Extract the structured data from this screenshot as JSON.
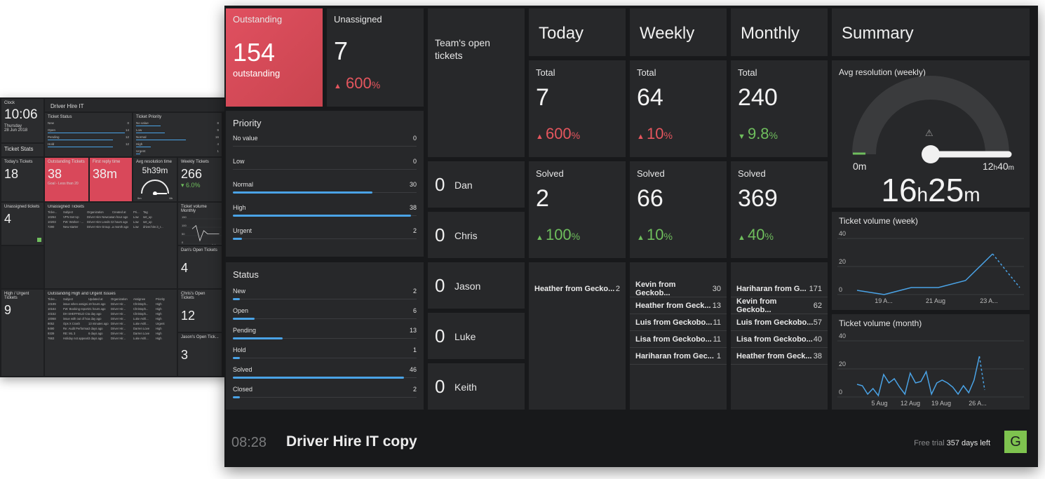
{
  "back": {
    "clock": {
      "label": "Clock",
      "time": "10:06",
      "day": "Thursday",
      "date": "28 Jun 2018"
    },
    "title": "Driver Hire IT",
    "ticket_stats": "Ticket Stats",
    "ticket_status": {
      "label": "Ticket Status",
      "rows": [
        {
          "k": "New",
          "v": "0",
          "w": 0.0
        },
        {
          "k": "Open",
          "v": "14",
          "w": 0.95
        },
        {
          "k": "Pending",
          "v": "12",
          "w": 0.8
        },
        {
          "k": "Hold",
          "v": "12",
          "w": 0.8
        }
      ]
    },
    "ticket_priority": {
      "label": "Ticket Priority",
      "rows": [
        {
          "k": "No value",
          "v": "8",
          "w": 0.3
        },
        {
          "k": "Low",
          "v": "9",
          "w": 0.35
        },
        {
          "k": "Normal",
          "v": "16",
          "w": 0.6
        },
        {
          "k": "High",
          "v": "4",
          "w": 0.18
        },
        {
          "k": "Urgent",
          "v": "1",
          "w": 0.05
        }
      ]
    },
    "todays": {
      "label": "Today's Tickets",
      "value": "18"
    },
    "outstanding": {
      "label": "Outstanding Tickets",
      "value": "38",
      "goal": "Goal - Less than 20"
    },
    "first_reply": {
      "label": "First reply time",
      "value": "38m"
    },
    "avg_res": {
      "label": "Avg resolution time",
      "value": "5h39m",
      "min": "0m",
      "max": "6h"
    },
    "weekly": {
      "label": "Weekly Tickets",
      "value": "266",
      "change": "6.0%"
    },
    "unassigned": {
      "label": "Unassigned tickets",
      "value": "4"
    },
    "unassigned_list": {
      "label": "Unassigned Tickets",
      "cols": [
        "Ticke...",
        "Subject",
        "Organization",
        "Created at",
        "Pri...",
        "Tag"
      ],
      "rows": [
        [
          "10264",
          "VPN Set Up",
          "Driver Hire Newcas...",
          "an hour ago",
          "Low",
          "set_up"
        ],
        [
          "10203",
          "FW: Worker - ...",
          "Driver Hire Leeds C...",
          "2 hours ago",
          "Low",
          "set_up"
        ],
        [
          "7290",
          "New starter",
          "Driver Hire Group ...",
          "a month ago",
          "Low",
          "driver.hire.it_r..."
        ]
      ]
    },
    "volume_monthly": {
      "label": "Ticket volume Monthly",
      "ticks": [
        "150",
        "100",
        "50",
        "0"
      ],
      "xlab": "8 Jun"
    },
    "dans": {
      "label": "Dan's Open Tickets",
      "value": "4"
    },
    "high_urgent": {
      "label": "High / Urgent Tickets",
      "value": "9"
    },
    "hu_list": {
      "label": "Outstanding High and Urgent Issues",
      "cols": [
        "Ticke...",
        "Subject",
        "Updated at",
        "Organization",
        "Assignee",
        "Priority"
      ],
      "rows": [
        [
          "10199",
          "issue when assigni...",
          "19 hours ago",
          "Driver Hir...",
          "Christoph...",
          "High"
        ],
        [
          "10164",
          "FW: Booking report...",
          "21 hours ago",
          "Driver Hir...",
          "Christoph...",
          "High"
        ],
        [
          "10152",
          "DH SHEFFIELD CSR...",
          "a day ago",
          "Driver Hir...",
          "Christoph...",
          "High"
        ],
        [
          "10068",
          "issue with out of ho...",
          "a day ago",
          "Driver Hir...",
          "Luke Ashl...",
          "High"
        ],
        [
          "9052",
          "Ops X Crash",
          "13 minutes ago",
          "Driver Hir...",
          "Luke Ashl...",
          "Urgent"
        ],
        [
          "9490",
          "Re: Audit Performan...",
          "3 days ago",
          "Driver Hir...",
          "Darren Love",
          "High"
        ],
        [
          "9339",
          "RE: ML 3",
          "6 days ago",
          "Driver Hir...",
          "Darren Love",
          "High"
        ],
        [
          "7663",
          "Holiday not appeari...",
          "3 days ago",
          "Driver Hir...",
          "Luke Ashl...",
          "High"
        ]
      ]
    },
    "chris": {
      "label": "Chris's Open Tickets",
      "value": "12"
    },
    "jason": {
      "label": "Jason's Open Tick...",
      "value": "3"
    }
  },
  "main": {
    "outstanding": {
      "label": "Outstanding",
      "value": "154",
      "sub": "outstanding"
    },
    "unassigned": {
      "label": "Unassigned",
      "value": "7",
      "change": "600",
      "unit": "%",
      "arrow": "▲"
    },
    "team": {
      "label": "Team's open tickets",
      "members": [
        {
          "count": "0",
          "name": "Dan"
        },
        {
          "count": "0",
          "name": "Chris"
        },
        {
          "count": "0",
          "name": "Jason"
        },
        {
          "count": "0",
          "name": "Luke"
        },
        {
          "count": "0",
          "name": "Keith"
        }
      ]
    },
    "priority": {
      "label": "Priority",
      "rows": [
        {
          "name": "No value",
          "value": "0",
          "fraction": 0.0
        },
        {
          "name": "Low",
          "value": "0",
          "fraction": 0.0
        },
        {
          "name": "Normal",
          "value": "30",
          "fraction": 0.76
        },
        {
          "name": "High",
          "value": "38",
          "fraction": 0.97
        },
        {
          "name": "Urgent",
          "value": "2",
          "fraction": 0.05
        }
      ]
    },
    "status": {
      "label": "Status",
      "rows": [
        {
          "name": "New",
          "value": "2",
          "fraction": 0.04
        },
        {
          "name": "Open",
          "value": "6",
          "fraction": 0.12
        },
        {
          "name": "Pending",
          "value": "13",
          "fraction": 0.27
        },
        {
          "name": "Hold",
          "value": "1",
          "fraction": 0.02
        },
        {
          "name": "Solved",
          "value": "46",
          "fraction": 0.93
        },
        {
          "name": "Closed",
          "value": "2",
          "fraction": 0.04
        }
      ]
    },
    "today": {
      "head": "Today",
      "total_label": "Total",
      "total": "7",
      "total_change": "600",
      "solved_label": "Solved",
      "solved": "2",
      "solved_change": "100",
      "unit": "%",
      "leaders": [
        {
          "name": "Heather from Gecko...",
          "n": "2"
        }
      ]
    },
    "weekly": {
      "head": "Weekly",
      "total_label": "Total",
      "total": "64",
      "total_change": "10",
      "solved_label": "Solved",
      "solved": "66",
      "solved_change": "10",
      "unit": "%",
      "leaders": [
        {
          "name": "Kevin from Geckob...",
          "n": "30"
        },
        {
          "name": "Heather from Geck...",
          "n": "13"
        },
        {
          "name": "Luis from Geckobo...",
          "n": "11"
        },
        {
          "name": "Lisa from Geckobo...",
          "n": "11"
        },
        {
          "name": "Hariharan from Gec...",
          "n": "1"
        }
      ]
    },
    "monthly": {
      "head": "Monthly",
      "total_label": "Total",
      "total": "240",
      "total_change": "9.8",
      "solved_label": "Solved",
      "solved": "369",
      "solved_change": "40",
      "unit": "%",
      "leaders": [
        {
          "name": "Hariharan from G...",
          "n": "171"
        },
        {
          "name": "Kevin from Geckob...",
          "n": "62"
        },
        {
          "name": "Luis from Geckobo...",
          "n": "57"
        },
        {
          "name": "Lisa from Geckobo...",
          "n": "40"
        },
        {
          "name": "Heather from Geck...",
          "n": "38"
        }
      ]
    },
    "summary": {
      "head": "Summary"
    },
    "avg_resolution": {
      "label": "Avg resolution (weekly)",
      "min": "0m",
      "max_h": "12",
      "max_m": "40",
      "value_h": "16",
      "value_m": "25",
      "h": "h",
      "m": "m",
      "warning": "⚠"
    },
    "footer": {
      "time": "08:28",
      "title": "Driver Hire IT copy",
      "trial_prefix": "Free trial",
      "trial_days": "357 days left",
      "logo": "G"
    },
    "colors": {
      "accent_red": "#d9485a",
      "bar_blue": "#4aa3e6",
      "up_green": "#6fbe5d",
      "down_red": "#e5565e",
      "logo_green": "#7ec34f"
    }
  },
  "chart_data": [
    {
      "type": "line",
      "title": "Ticket volume (week)",
      "x": [
        "19 Aug",
        "20 Aug",
        "21 Aug",
        "22 Aug",
        "23 Aug",
        "24 Aug",
        "25 Aug"
      ],
      "y": [
        3,
        0,
        5,
        5,
        10,
        29,
        5
      ],
      "xticks": [
        "19 A...",
        "21 Aug",
        "23 A..."
      ],
      "ylim": [
        0,
        40
      ],
      "yticks": [
        0,
        20,
        40
      ],
      "dashed_last_segment": true
    },
    {
      "type": "line",
      "title": "Ticket volume (month)",
      "x": [
        "1 Aug",
        "2",
        "3",
        "4",
        "5 Aug",
        "6",
        "7",
        "8",
        "9",
        "10",
        "11",
        "12 Aug",
        "13",
        "14",
        "15",
        "16",
        "17",
        "18",
        "19 Aug",
        "20",
        "21",
        "22",
        "23",
        "24",
        "25"
      ],
      "y": [
        9,
        8,
        2,
        6,
        1,
        16,
        10,
        13,
        7,
        2,
        17,
        10,
        11,
        18,
        2,
        10,
        12,
        10,
        7,
        2,
        8,
        3,
        12,
        29,
        5
      ],
      "xticks": [
        "5 Aug",
        "12 Aug",
        "19 Aug",
        "26 A..."
      ],
      "ylim": [
        0,
        40
      ],
      "yticks": [
        0,
        20,
        40
      ],
      "dashed_last_segment": true
    },
    {
      "type": "line",
      "title": "Ticket volume Monthly",
      "x": [
        "1",
        "2",
        "3",
        "4",
        "5",
        "6",
        "7",
        "8"
      ],
      "y": [
        90,
        110,
        20,
        80,
        60,
        60,
        60,
        60
      ],
      "xticks": [
        "8 Jun"
      ],
      "ylim": [
        0,
        150
      ],
      "yticks": [
        0,
        50,
        100,
        150
      ]
    }
  ]
}
